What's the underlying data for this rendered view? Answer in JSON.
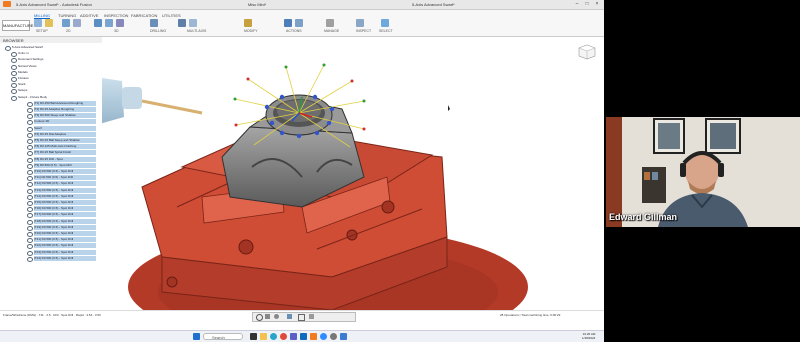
{
  "titlebar": {
    "app_title": "5-Axis Advanced Swarf* - Autodesk Fusion",
    "document_tab": "Misc Mini*",
    "document_tab_2": "5-Axis Advanced Swarf*"
  },
  "workspace": {
    "label": "MANUFACTURE"
  },
  "ribbon": {
    "tabs": [
      "MILLING",
      "TURNING",
      "ADDITIVE",
      "INSPECTION",
      "FABRICATION",
      "UTILITIES"
    ],
    "groups": [
      "SETUP",
      "2D",
      "3D",
      "DRILLING",
      "MULTI-AXIS",
      "MODIFY",
      "ACTIONS",
      "MANAGE",
      "INSPECT",
      "SELECT"
    ]
  },
  "browser": {
    "title": "BROWSER",
    "rows": [
      "5-Axis Advanced Swarf",
      "Units: in",
      "Document Settings",
      "Named Views",
      "Models",
      "Fixtures",
      "Stock",
      "Setups",
      "Setup1 - Fixture Body",
      "[T1] D0.250 Ball Advanced Roughing",
      "[T2] D0.25 Adaptive Roughing",
      "[T3] D0.500 Steep and Shallow",
      "Contour 2D",
      "Swarf",
      "[T4] D0.25 Flat Adaptive",
      "[T5] D0.25 Ball Steep and Shallow",
      "[T6] D0.125 Multi-Axis Finishing",
      "[T7] D0.25 Ball Spiral Finish",
      "[T8] D0.25 Drill - Spot",
      "[T9] D0.500 (0.5) - Spot Drill",
      "[T10] D0.500 (0.5) - Spot Drill",
      "[T11] D0.500 (0.5) - Spot Drill",
      "[T12] D0.500 (0.5) - Spot Drill",
      "[T13] D0.500 (0.5) - Spot Drill",
      "[T14] D0.500 (0.5) - Spot Drill",
      "[T15] D0.500 (0.5) - Spot Drill",
      "[T16] D0.500 (0.5) - Spot Drill",
      "[T17] D0.500 (0.5) - Spot Drill",
      "[T18] D0.500 (0.5) - Spot Drill",
      "[T19] D0.500 (0.5) - Spot Drill",
      "[T20] D0.500 (0.5) - Spot Drill",
      "[T21] D0.500 (0.5) - Spot Drill",
      "[T22] D0.500 (0.5) - Spot Drill",
      "[T23] D0.500 (0.5) - Spot Drill",
      "[T24] D0.500 (0.5) - Spot Drill"
    ]
  },
  "status": {
    "left": "Frame/Wireframe (DMG) · T11 · 2.5 · Drill · Spot Drill · Rapid · 3:54 · 3:56",
    "right": "28 Operations | Total machining time: 0:06:29"
  },
  "taskbar": {
    "search": "Search",
    "time": "10:26 AM",
    "date": "1/18/2024"
  },
  "webcam": {
    "name": "Edward Gillman"
  },
  "colors": {
    "fixture": "#c94a34",
    "part": "#8a8a8a",
    "selection": "#b9d3ea",
    "accent": "#0a64c8"
  }
}
